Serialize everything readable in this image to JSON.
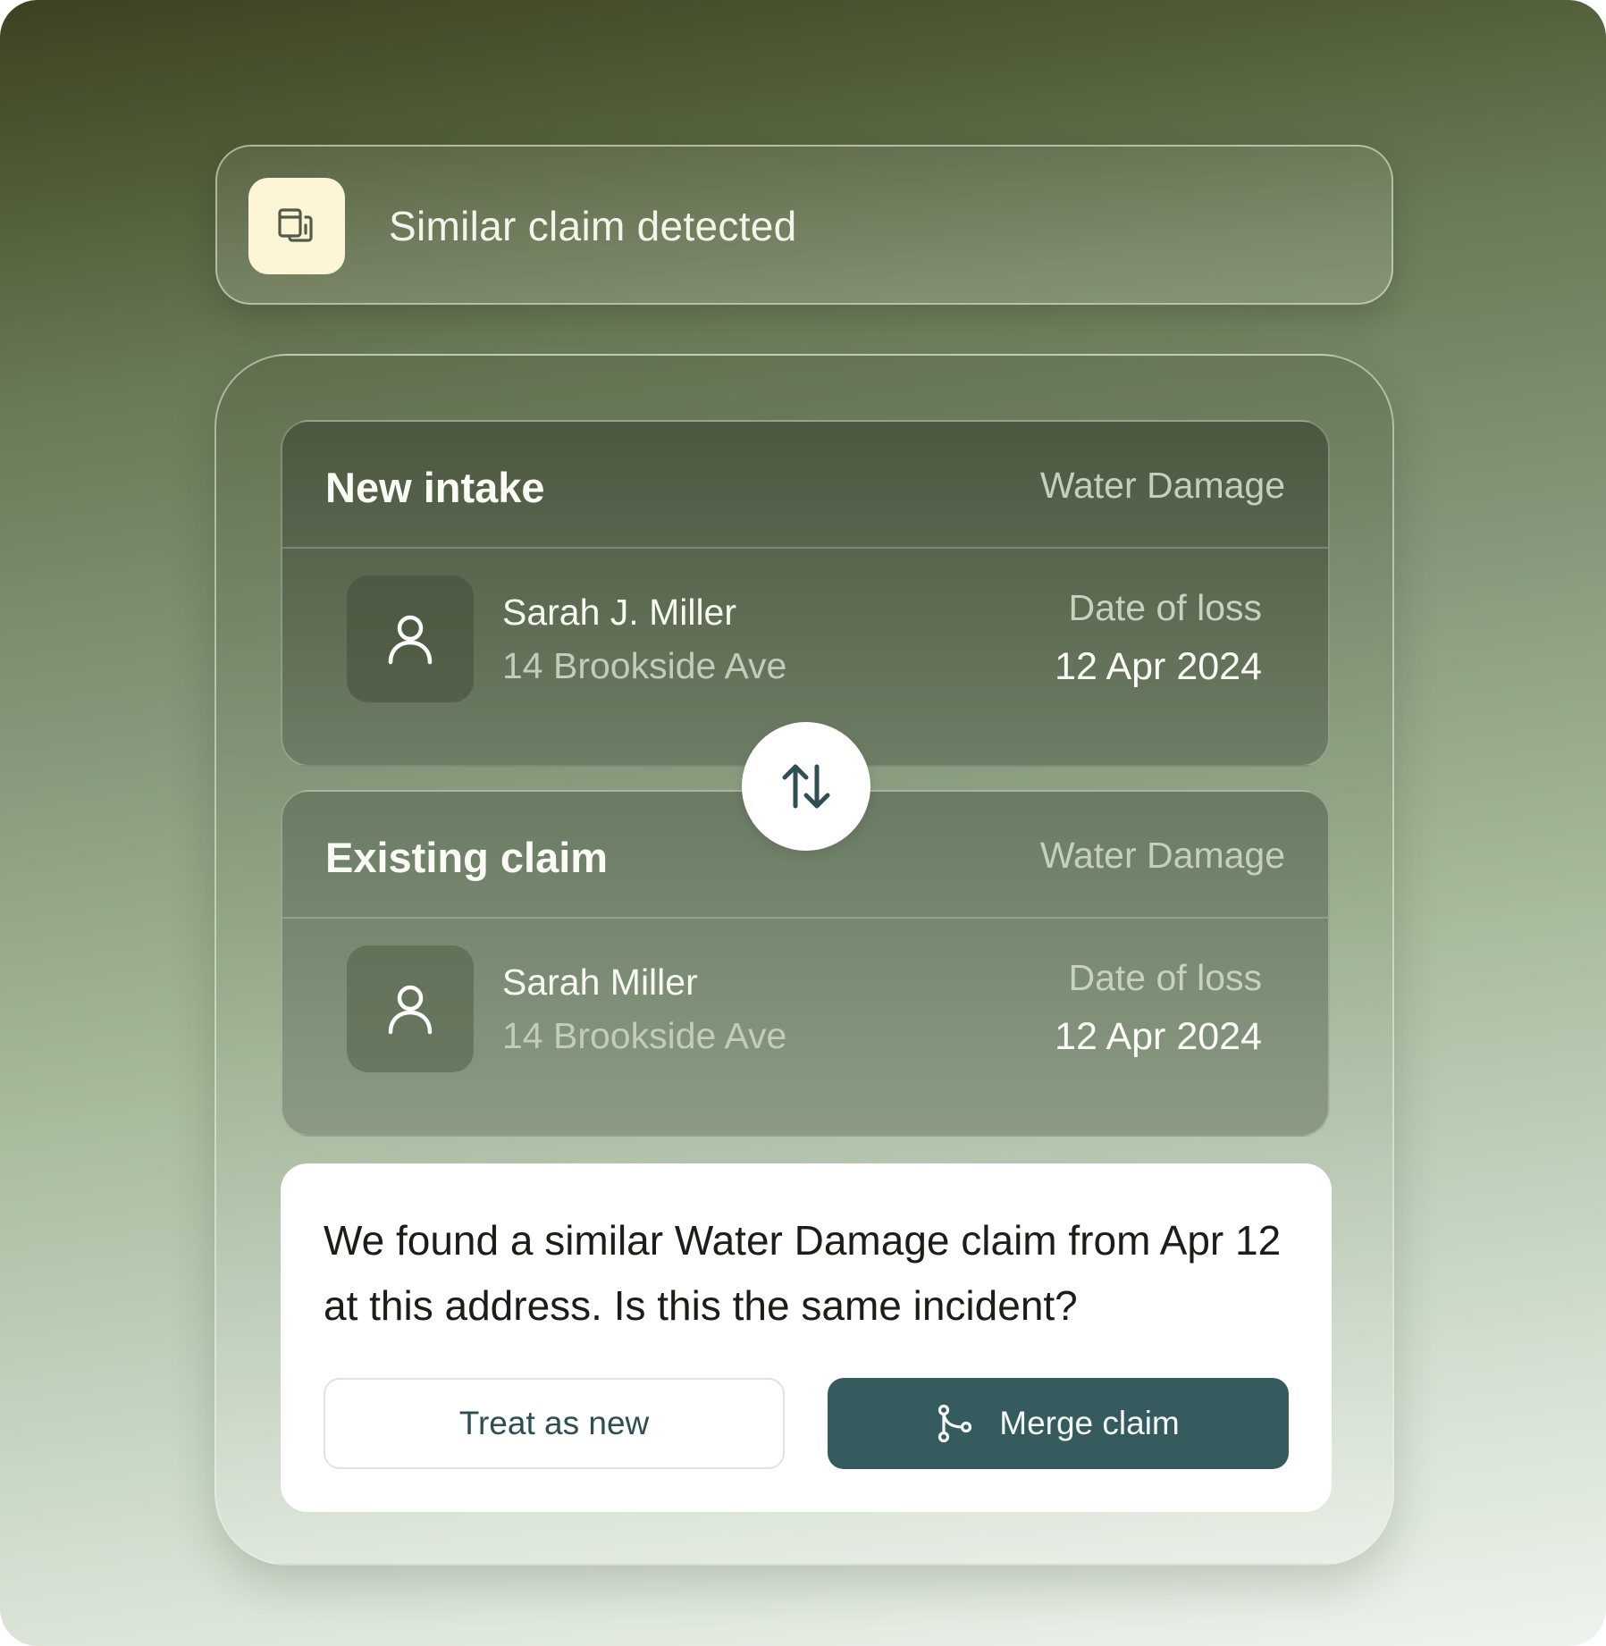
{
  "banner": {
    "title": "Similar claim detected",
    "icon": "duplicate-document-icon"
  },
  "new_intake": {
    "title": "New intake",
    "claim_type": "Water Damage",
    "name": "Sarah J. Miller",
    "address": "14 Brookside Ave",
    "date_of_loss_label": "Date of loss",
    "date_of_loss": "12 Apr 2024",
    "icon": "user-icon"
  },
  "swap": {
    "icon": "swap-vertical-icon"
  },
  "existing_claim": {
    "title": "Existing claim",
    "claim_type": "Water Damage",
    "name": "Sarah Miller",
    "address": "14 Brookside Ave",
    "date_of_loss_label": "Date of loss",
    "date_of_loss": "12 Apr 2024",
    "icon": "user-icon"
  },
  "prompt": {
    "message": "We found a similar Water Damage claim from Apr 12 at this address. Is this the same incident?",
    "treat_as_new_label": "Treat as new",
    "merge_label": "Merge claim",
    "merge_icon": "merge-branch-icon"
  },
  "colors": {
    "primary_button": "#365b5e",
    "banner_icon_bg": "#fcf6d6",
    "secondary_text": "#2c4f50"
  }
}
